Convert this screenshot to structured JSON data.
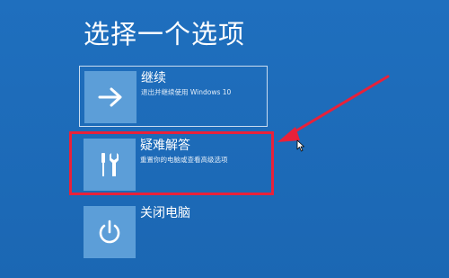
{
  "page": {
    "title": "选择一个选项"
  },
  "options": [
    {
      "title": "继续",
      "description": "退出并继续使用 Windows 10",
      "icon": "arrow-right-icon"
    },
    {
      "title": "疑难解答",
      "description": "重置你的电脑或查看高级选项",
      "icon": "tools-icon"
    },
    {
      "title": "关闭电脑",
      "description": "",
      "icon": "power-icon"
    }
  ],
  "colors": {
    "background": "#1e6bb8",
    "tile": "#5c9ed8",
    "annotation": "#e8213a"
  }
}
